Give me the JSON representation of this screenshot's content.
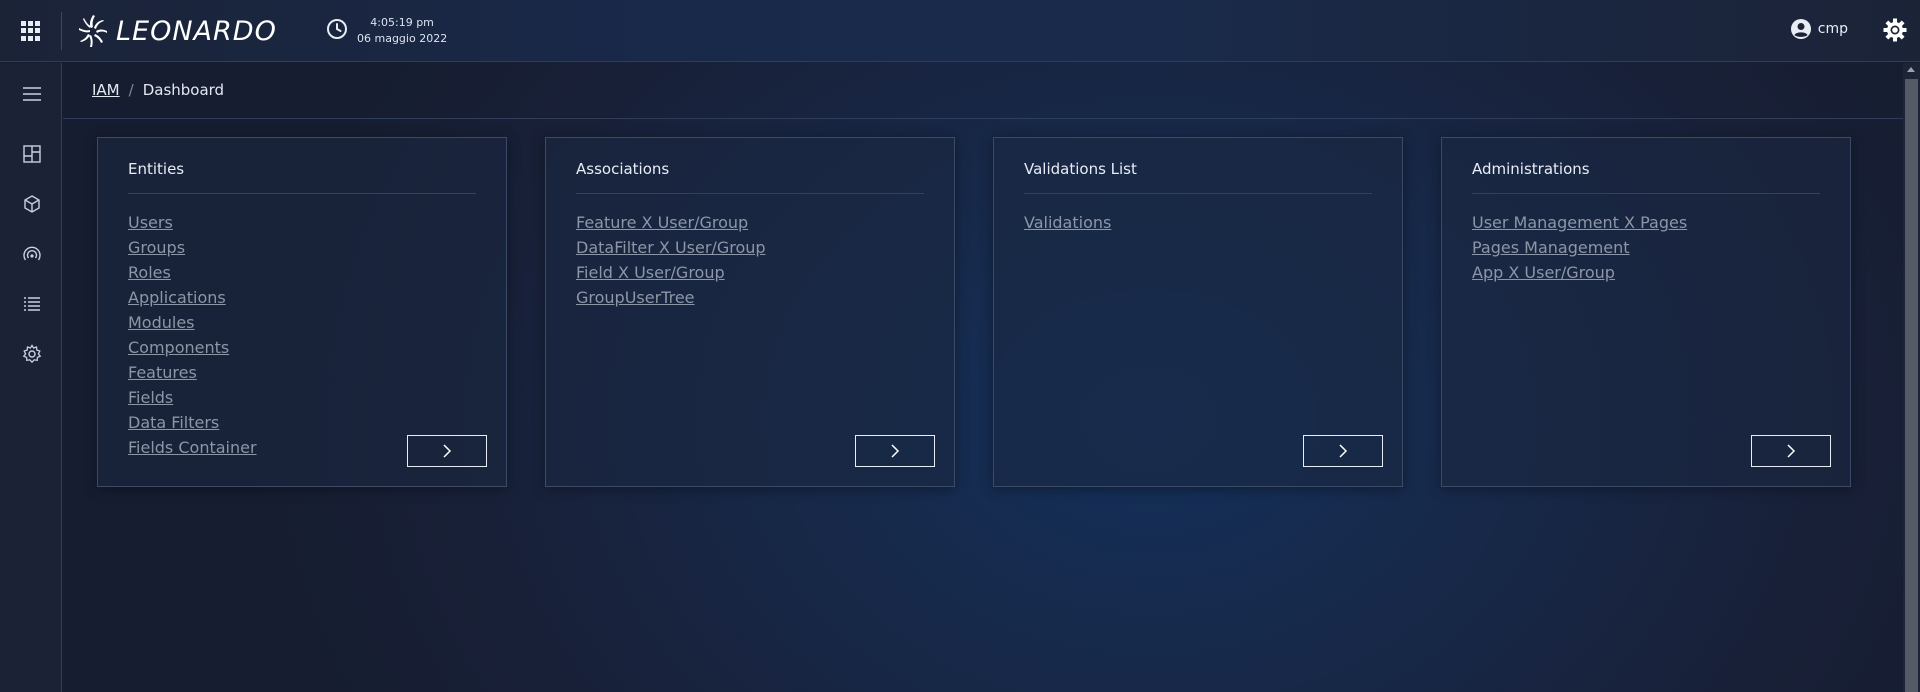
{
  "header": {
    "brand": "LEONARDO",
    "time": "4:05:19 pm",
    "date": "06 maggio 2022",
    "user": "cmp"
  },
  "breadcrumb": {
    "root": "IAM",
    "current": "Dashboard"
  },
  "cards": [
    {
      "title": "Entities",
      "links": [
        "Users",
        "Groups",
        "Roles",
        "Applications",
        "Modules",
        "Components",
        "Features",
        "Fields",
        "Data Filters",
        "Fields Container"
      ]
    },
    {
      "title": "Associations",
      "links": [
        "Feature X User/Group",
        "DataFilter X User/Group",
        "Field X User/Group",
        "GroupUserTree"
      ]
    },
    {
      "title": "Validations List",
      "links": [
        "Validations"
      ]
    },
    {
      "title": "Administrations",
      "links": [
        "User Management X Pages",
        "Pages Management",
        "App X User/Group"
      ]
    }
  ],
  "icons": {
    "apps": "apps-grid-icon",
    "clock": "clock-icon",
    "user": "account-circle-icon",
    "settings": "gear-icon",
    "menu": "hamburger-icon",
    "rail": [
      "dashboard-icon",
      "package-icon",
      "signal-icon",
      "list-icon",
      "gear-icon"
    ],
    "card_action": "chevron-right-icon"
  }
}
